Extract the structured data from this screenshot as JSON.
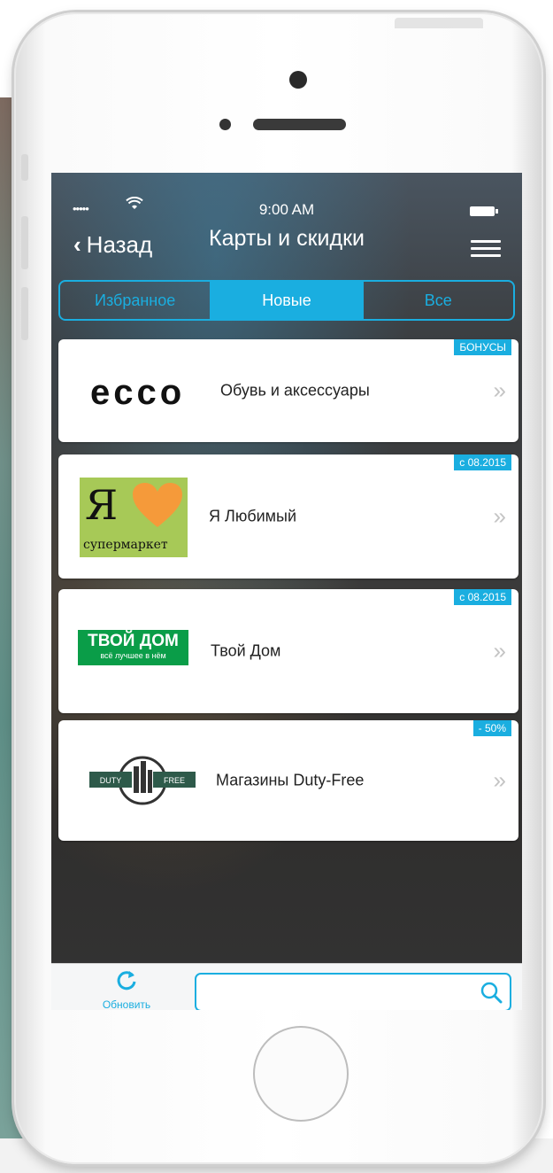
{
  "status_bar": {
    "signal": "•••••",
    "time": "9:00 AM"
  },
  "nav": {
    "back_label": "Назад",
    "title": "Карты и скидки"
  },
  "tabs": [
    {
      "label": "Избранное",
      "active": false
    },
    {
      "label": "Новые",
      "active": true
    },
    {
      "label": "Все",
      "active": false
    }
  ],
  "cards": [
    {
      "logo_text": "ecco",
      "name": "Обувь и аксессуары",
      "badge": "БОНУСЫ"
    },
    {
      "logo_text": "Я",
      "logo_sub": "супермаркет",
      "name": "Я Любимый",
      "badge": "с 08.2015"
    },
    {
      "logo_text": "ТВОЙ ДОМ",
      "logo_sub": "всё лучшее в нём",
      "name": "Твой Дом",
      "badge": "с 08.2015"
    },
    {
      "logo_text": "DUTY FREE",
      "name": "Магазины Duty-Free",
      "badge": "- 50%"
    }
  ],
  "card_chevron": "»",
  "toolbar": {
    "refresh_label": "Обновить",
    "search_value": "",
    "search_placeholder": ""
  },
  "colors": {
    "accent": "#1aaee0",
    "td_green": "#0a9d48",
    "ya_green": "#a7c957",
    "ya_heart": "#f59a3a"
  }
}
